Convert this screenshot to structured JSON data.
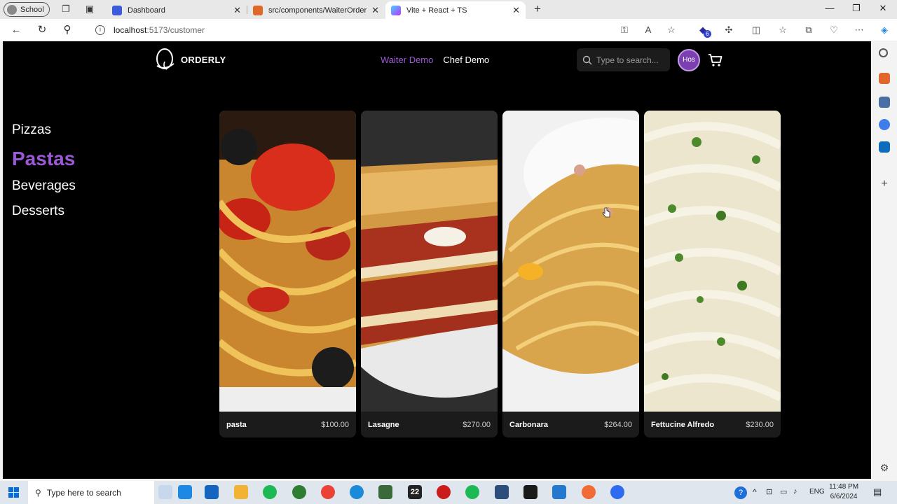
{
  "browser": {
    "profile_label": "School",
    "tabs": [
      {
        "title": "Dashboard",
        "color": "#3b5bdb"
      },
      {
        "title": "src/components/WaiterOrderCa",
        "color": "#e0662b"
      },
      {
        "title": "Vite + React + TS",
        "color": "#a259ff"
      }
    ],
    "url_host": "localhost",
    "url_path": ":5173/customer",
    "extension_badge": "6"
  },
  "app": {
    "brand": "ORDERLY",
    "nav": [
      {
        "label": "Waiter Demo",
        "active": true
      },
      {
        "label": "Chef Demo",
        "active": false
      }
    ],
    "search_placeholder": "Type to search...",
    "avatar_initials": "Hos",
    "categories": [
      {
        "label": "Pizzas",
        "active": false
      },
      {
        "label": "Pastas",
        "active": true
      },
      {
        "label": "Beverages",
        "active": false
      },
      {
        "label": "Desserts",
        "active": false
      }
    ],
    "items": [
      {
        "name": "pasta",
        "price": "$100.00",
        "image": "spaghetti-tomato-photo"
      },
      {
        "name": "Lasagne",
        "price": "$270.00",
        "image": "lasagne-photo"
      },
      {
        "name": "Carbonara",
        "price": "$264.00",
        "image": "carbonara-photo"
      },
      {
        "name": "Fettucine Alfredo",
        "price": "$230.00",
        "image": "fettucine-alfredo-photo"
      }
    ],
    "accent_color": "#9b59d6"
  },
  "taskbar": {
    "search_placeholder": "Type here to search",
    "app_badge": "22",
    "language": "ENG",
    "time": "11:48 PM",
    "date": "6/6/2024"
  }
}
